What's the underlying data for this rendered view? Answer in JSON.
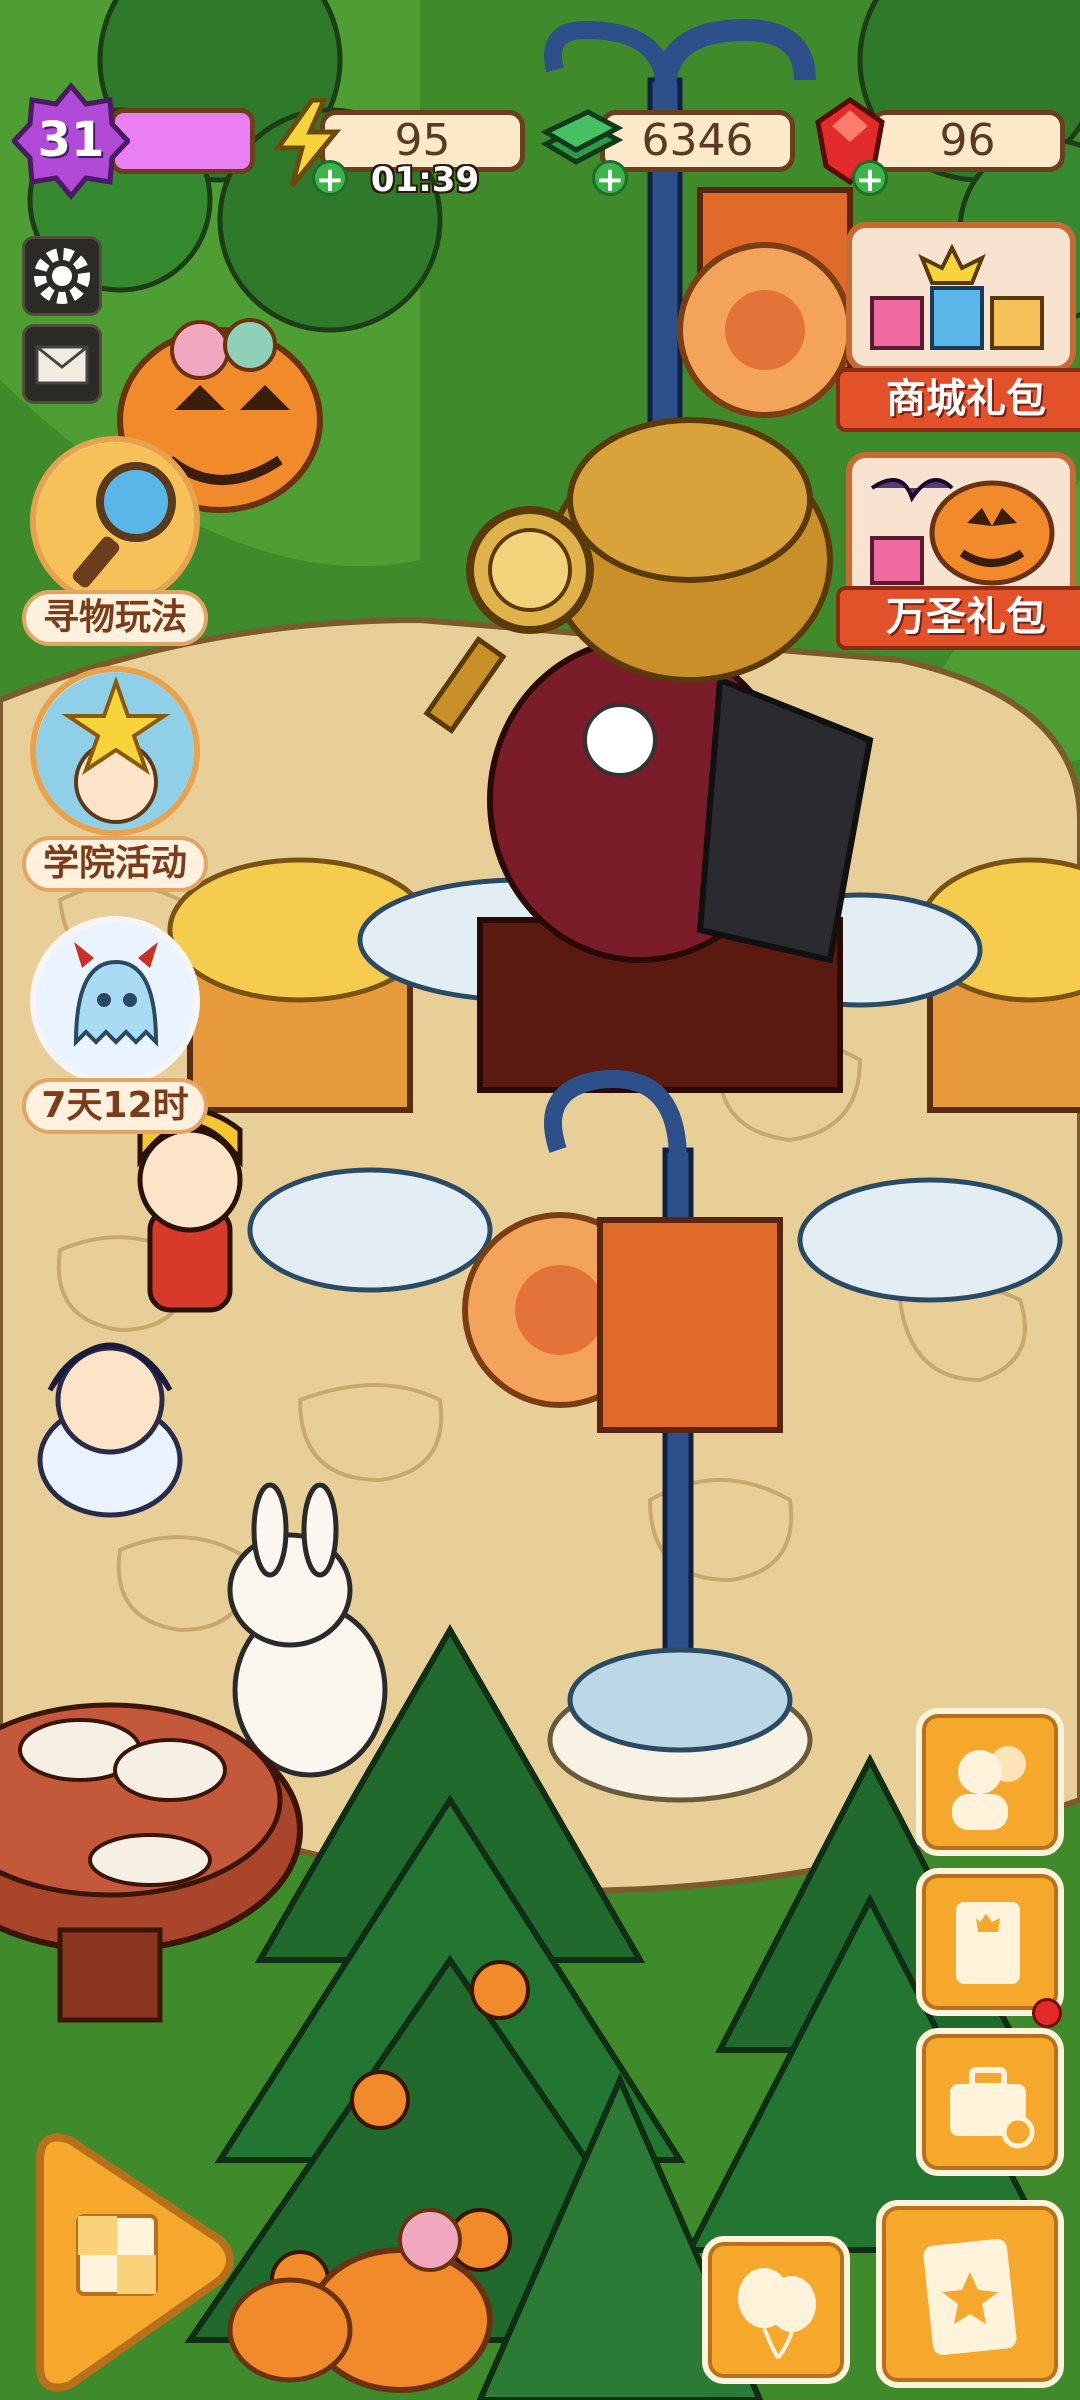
{
  "hud": {
    "level": "31",
    "energy": "95",
    "energy_timer": "01:39",
    "cash": "6346",
    "gems": "96"
  },
  "side_events": [
    {
      "label": "寻物玩法"
    },
    {
      "label": "学院活动"
    },
    {
      "label": "7天12时"
    }
  ],
  "packs": [
    {
      "label": "商城礼包"
    },
    {
      "label": "万圣礼包"
    }
  ],
  "colors": {
    "grass": "#3f8a2a",
    "path": "#e8cf98",
    "accent_orange": "#f6a82c",
    "banner_red": "#e2512a",
    "level_purple": "#b24ad8"
  }
}
